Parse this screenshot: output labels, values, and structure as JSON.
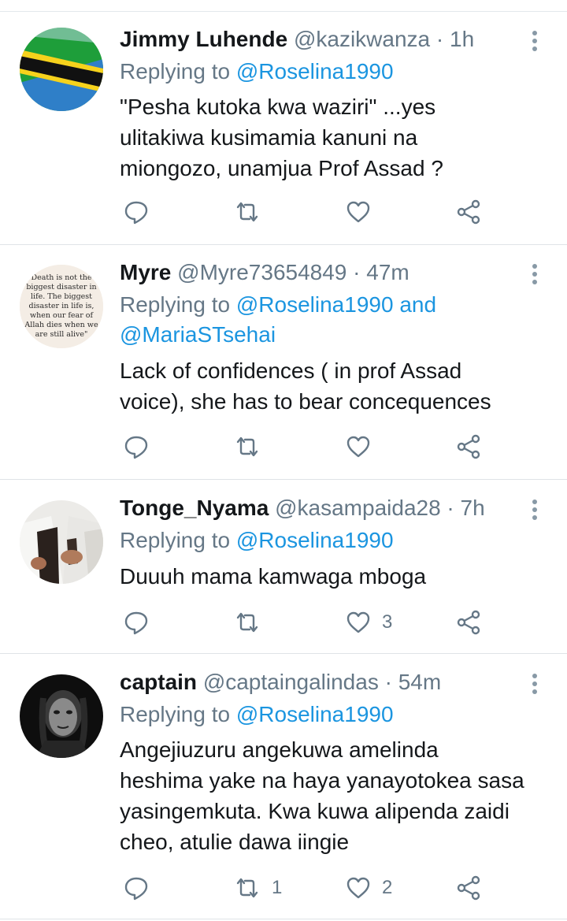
{
  "tweets": [
    {
      "name": "Jimmy Luhende",
      "handle": "@kazikwanza",
      "time": "1h",
      "replying_prefix": "Replying to ",
      "mentions": [
        "@Roselina1990"
      ],
      "text_lines": [
        "\"Pesha kutoka kwa waziri\" ...yes",
        "ulitakiwa kusimamia kanuni na",
        "miongozo, unamjua Prof Assad ?"
      ],
      "retweet_count": "",
      "like_count": ""
    },
    {
      "name": "Myre",
      "handle": "@Myre73654849",
      "time": "47m",
      "replying_prefix": "Replying to ",
      "mentions": [
        "@Roselina1990",
        "@MariaSTsehai"
      ],
      "mention_joiner": " and",
      "avatar_text": [
        "Death is not the",
        "biggest disaster in",
        "life. The biggest",
        "disaster in life is,",
        "when our fear of",
        "Allah dies when we",
        "are still alive\""
      ],
      "text_lines": [
        "Lack of confidences ( in prof Assad",
        "voice), she has to bear concequences"
      ],
      "retweet_count": "",
      "like_count": ""
    },
    {
      "name": "Tonge_Nyama",
      "handle": "@kasampaida28",
      "time": "7h",
      "replying_prefix": "Replying to ",
      "mentions": [
        "@Roselina1990"
      ],
      "text_lines": [
        "Duuuh mama kamwaga mboga"
      ],
      "retweet_count": "",
      "like_count": "3"
    },
    {
      "name": "captain",
      "handle": "@captaingalindas",
      "time": "54m",
      "replying_prefix": "Replying to ",
      "mentions": [
        "@Roselina1990"
      ],
      "text_lines": [
        "Angejiuzuru angekuwa amelinda",
        "heshima yake na haya yanayotokea sasa",
        "yasingemkuta. Kwa kuwa alipenda zaidi",
        "cheo, atulie dawa iingie"
      ],
      "retweet_count": "1",
      "like_count": "2"
    }
  ],
  "separator": " · ",
  "icons": [
    "reply-icon",
    "retweet-icon",
    "like-icon",
    "share-icon",
    "more-options-icon"
  ],
  "colors": {
    "mention": "#1b95e0",
    "secondary": "#657786",
    "text": "#14171a",
    "divider": "#dfe3e7"
  }
}
